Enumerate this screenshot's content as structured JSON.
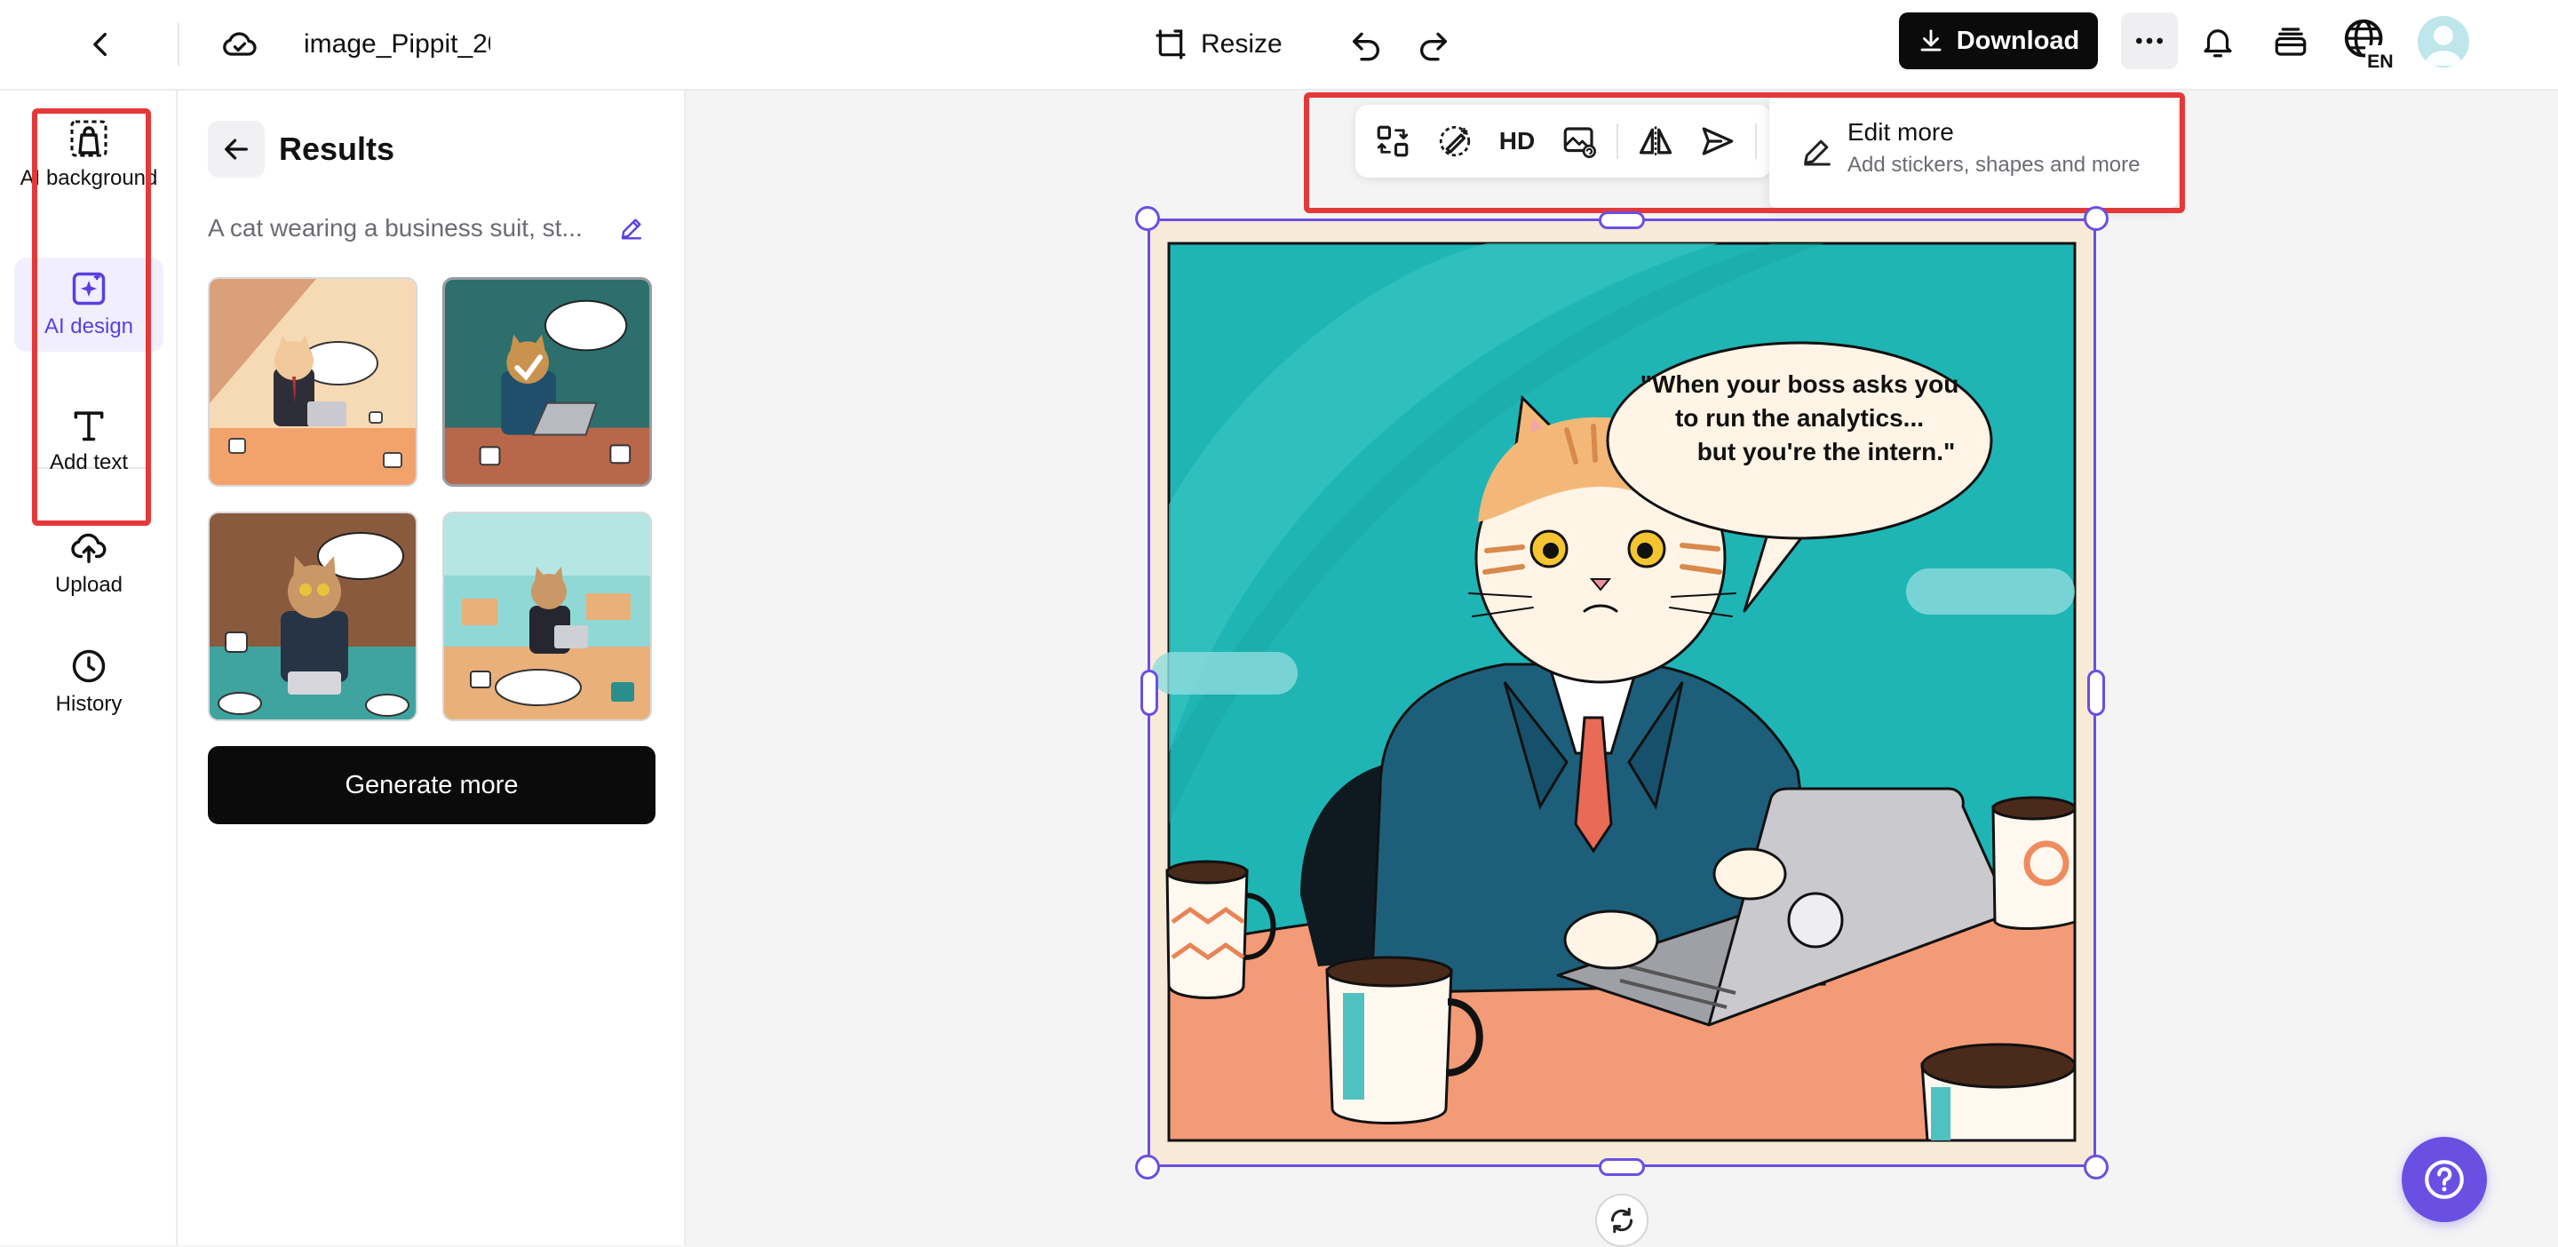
{
  "topbar": {
    "doc_title": "image_Pippit_20",
    "resize_label": "Resize",
    "download_label": "Download",
    "lang_code": "EN"
  },
  "rail": {
    "items": [
      {
        "label": "AI background",
        "icon": "ai-background-icon"
      },
      {
        "label": "AI design",
        "icon": "ai-design-icon",
        "active": true
      },
      {
        "label": "Add text",
        "icon": "text-icon"
      },
      {
        "label": "Upload",
        "icon": "upload-cloud-icon"
      },
      {
        "label": "History",
        "icon": "clock-icon"
      }
    ]
  },
  "results": {
    "title": "Results",
    "prompt": "A cat wearing a business suit, st...",
    "generate_label": "Generate more",
    "thumbnails": [
      {
        "name": "result-1"
      },
      {
        "name": "result-2",
        "selected": true
      },
      {
        "name": "result-3"
      },
      {
        "name": "result-4"
      }
    ]
  },
  "toolbar": {
    "hd_label": "HD",
    "edit_more_title": "Edit more",
    "edit_more_sub": "Add stickers, shapes and more"
  },
  "artwork": {
    "speech": [
      "\"When your boss asks you",
      "to run the analytics...",
      "but you're the intern.\""
    ],
    "colors": {
      "teal": "#1fb5b5",
      "table": "#f39a77",
      "suit": "#1d5f7a",
      "accent": "#6a4fe3"
    }
  }
}
